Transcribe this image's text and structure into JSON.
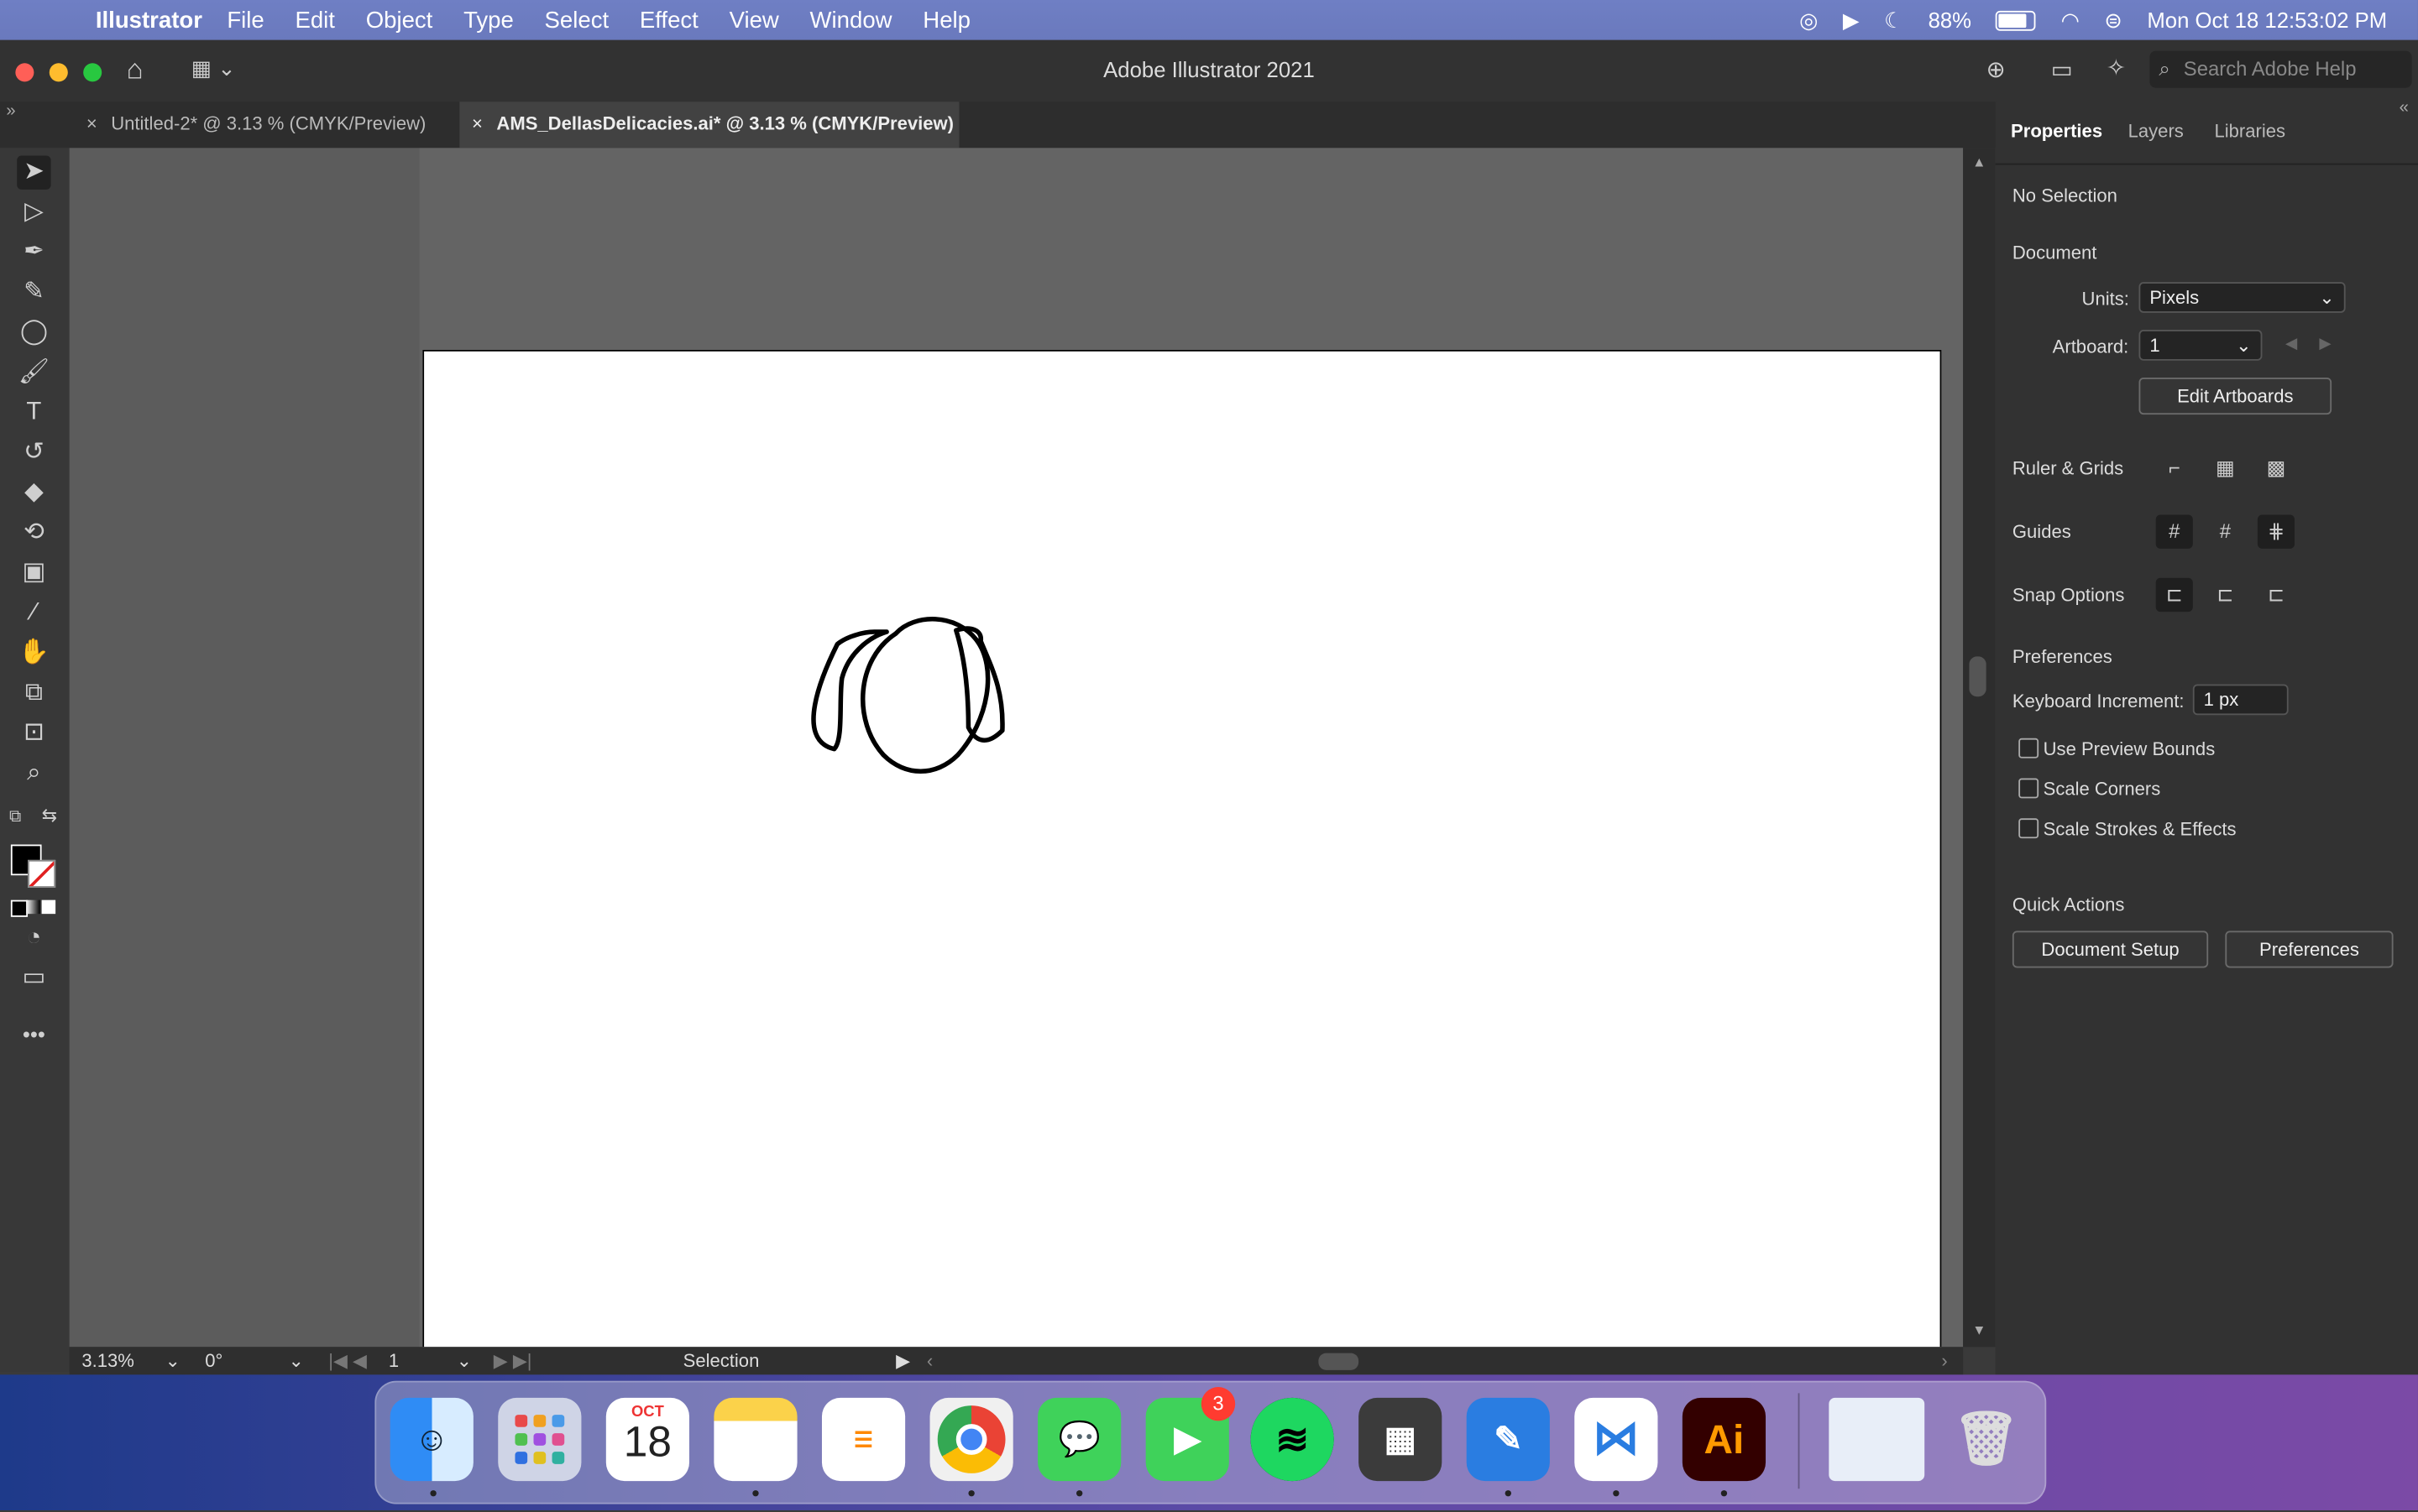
{
  "menubar": {
    "app_name": "Illustrator",
    "items": [
      "File",
      "Edit",
      "Object",
      "Type",
      "Select",
      "Effect",
      "View",
      "Window",
      "Help"
    ],
    "battery": "88%",
    "battery_level": 0.88,
    "datetime": "Mon Oct 18  12:53:02 PM"
  },
  "window": {
    "title": "Adobe Illustrator 2021",
    "search_placeholder": "Search Adobe Help"
  },
  "tabs": [
    {
      "label": "Untitled-2* @ 3.13 % (CMYK/Preview)",
      "active": false
    },
    {
      "label": "AMS_DellasDelicacies.ai* @ 3.13 % (CMYK/Preview)",
      "active": true
    }
  ],
  "statusbar": {
    "zoom": "3.13%",
    "rotation": "0°",
    "artboard_num": "1",
    "tool": "Selection"
  },
  "panel": {
    "tabs": [
      "Properties",
      "Layers",
      "Libraries"
    ],
    "selection": "No Selection",
    "document_heading": "Document",
    "units_label": "Units:",
    "units_value": "Pixels",
    "artboard_label": "Artboard:",
    "artboard_value": "1",
    "edit_artboards": "Edit Artboards",
    "ruler_grids": "Ruler & Grids",
    "guides": "Guides",
    "snap_options": "Snap Options",
    "preferences_heading": "Preferences",
    "keyboard_increment_label": "Keyboard Increment:",
    "keyboard_increment_value": "1 px",
    "checkboxes": [
      "Use Preview Bounds",
      "Scale Corners",
      "Scale Strokes & Effects"
    ],
    "quick_actions": "Quick Actions",
    "document_setup": "Document Setup",
    "preferences_button": "Preferences"
  },
  "dock": {
    "calendar_month": "OCT",
    "calendar_day": "18",
    "facetime_badge": "3",
    "illustrator_label": "Ai"
  },
  "colors": {
    "menubar": "#6f7fc4",
    "ui_dark": "#323232",
    "artboard": "#ffffff",
    "illustrator_brand": "#ff9a00"
  }
}
